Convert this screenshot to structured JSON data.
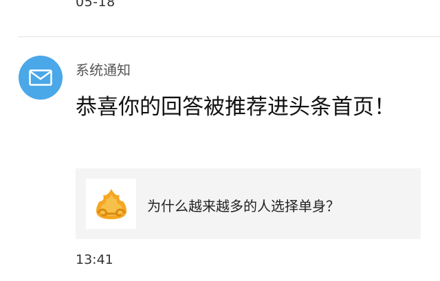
{
  "previous_message": {
    "timestamp": "05-18"
  },
  "notification": {
    "avatar_icon": "mail-envelope-icon",
    "avatar_color": "#4aa8e8",
    "sender": "系统通知",
    "message": "恭喜你的回答被推荐进头条首页！",
    "card": {
      "thumbnail_icon": "golden-crown-logo",
      "title": "为什么越来越多的人选择单身？"
    },
    "timestamp": "13:41"
  }
}
